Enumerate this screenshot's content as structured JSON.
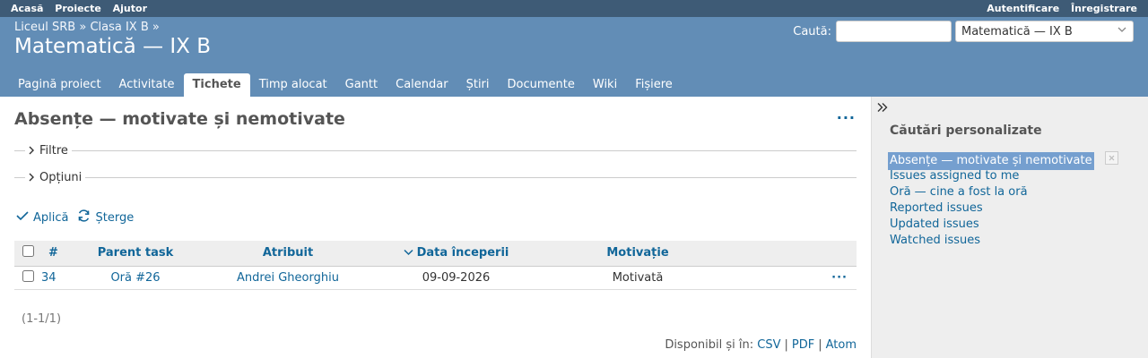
{
  "top_menu": {
    "left": [
      "Acasă",
      "Proiecte",
      "Ajutor"
    ],
    "right": [
      "Autentificare",
      "Înregistrare"
    ]
  },
  "header": {
    "breadcrumb": [
      "Liceul SRB",
      "»",
      "Clasa IX B",
      "»"
    ],
    "project_title": "Matematică — IX B",
    "search_label": "Caută:",
    "search_value": "",
    "project_jump": "Matematică — IX B"
  },
  "main_menu": [
    {
      "label": "Pagină proiect",
      "selected": false
    },
    {
      "label": "Activitate",
      "selected": false
    },
    {
      "label": "Tichete",
      "selected": true
    },
    {
      "label": "Timp alocat",
      "selected": false
    },
    {
      "label": "Gantt",
      "selected": false
    },
    {
      "label": "Calendar",
      "selected": false
    },
    {
      "label": "Știri",
      "selected": false
    },
    {
      "label": "Documente",
      "selected": false
    },
    {
      "label": "Wiki",
      "selected": false
    },
    {
      "label": "Fișiere",
      "selected": false
    }
  ],
  "content": {
    "title": "Absențe — motivate și nemotivate",
    "more_icon": "ellipsis-icon",
    "filters_label": "Filtre",
    "options_label": "Opțiuni",
    "apply_label": "Aplică",
    "clear_label": "Șterge",
    "table": {
      "columns": [
        "#",
        "Parent task",
        "Atribuit",
        "Data începerii",
        "Motivație"
      ],
      "sorted_column": "Data începerii",
      "rows": [
        {
          "id": "34",
          "parent": "Oră #26",
          "assignee": "Andrei Gheorghiu",
          "start_date": "09-09-2026",
          "motivation": "Motivată"
        }
      ]
    },
    "pagination": "(1-1/1)",
    "formats_label": "Disponibil și în:",
    "formats": [
      "CSV",
      "PDF",
      "Atom"
    ]
  },
  "sidebar": {
    "title": "Căutări personalizate",
    "queries": [
      {
        "label": "Absențe — motivate și nemotivate",
        "selected": true
      },
      {
        "label": "Issues assigned to me",
        "selected": false
      },
      {
        "label": "Oră — cine a fost la oră",
        "selected": false
      },
      {
        "label": "Reported issues",
        "selected": false
      },
      {
        "label": "Updated issues",
        "selected": false
      },
      {
        "label": "Watched issues",
        "selected": false
      }
    ]
  },
  "colors": {
    "top_menu_bg": "#3E5B76",
    "header_bg": "#628DB6",
    "link": "#169",
    "selected_query_bg": "#759FCF",
    "sidebar_bg": "#eeeeee"
  }
}
